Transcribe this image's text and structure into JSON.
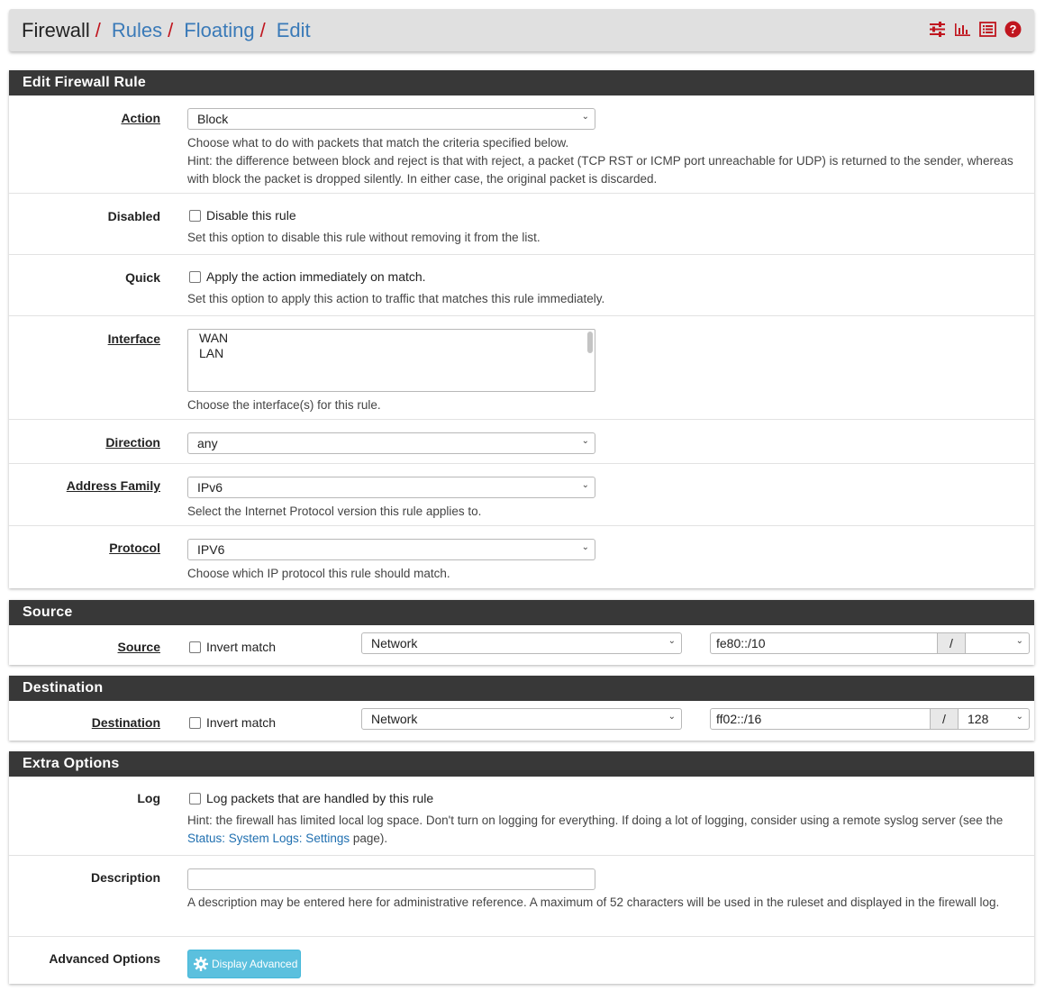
{
  "breadcrumb": {
    "home": "Firewall",
    "items": [
      "Rules",
      "Floating",
      "Edit"
    ]
  },
  "icons": [
    "sliders-icon",
    "bar-chart-icon",
    "list-icon",
    "help-icon"
  ],
  "colors": {
    "accent": "#c0161f",
    "link": "#3a7ab8",
    "header_bg": "#383838",
    "info_button": "#5bc0de"
  },
  "edit_rule": {
    "heading": "Edit Firewall Rule",
    "action": {
      "label": "Action",
      "value": "Block",
      "help1": "Choose what to do with packets that match the criteria specified below.",
      "help2": "Hint: the difference between block and reject is that with reject, a packet (TCP RST or ICMP port unreachable for UDP) is returned to the sender, whereas with block the packet is dropped silently. In either case, the original packet is discarded."
    },
    "disabled": {
      "label": "Disabled",
      "checkbox": "Disable this rule",
      "help": "Set this option to disable this rule without removing it from the list."
    },
    "quick": {
      "label": "Quick",
      "checkbox": "Apply the action immediately on match.",
      "help": "Set this option to apply this action to traffic that matches this rule immediately."
    },
    "interface": {
      "label": "Interface",
      "options": [
        "WAN",
        "LAN"
      ],
      "help": "Choose the interface(s) for this rule."
    },
    "direction": {
      "label": "Direction",
      "value": "any"
    },
    "address_family": {
      "label": "Address Family",
      "value": "IPv6",
      "help": "Select the Internet Protocol version this rule applies to."
    },
    "protocol": {
      "label": "Protocol",
      "value": "IPV6",
      "help": "Choose which IP protocol this rule should match."
    }
  },
  "source": {
    "heading": "Source",
    "label": "Source",
    "invert": "Invert match",
    "type": "Network",
    "address": "fe80::/10",
    "slash": "/",
    "mask": ""
  },
  "destination": {
    "heading": "Destination",
    "label": "Destination",
    "invert": "Invert match",
    "type": "Network",
    "address": "ff02::/16",
    "slash": "/",
    "mask": "128"
  },
  "extra": {
    "heading": "Extra Options",
    "log": {
      "label": "Log",
      "checkbox": "Log packets that are handled by this rule",
      "help_pre": "Hint: the firewall has limited local log space. Don't turn on logging for everything. If doing a lot of logging, consider using a remote syslog server (see the",
      "help_link": "Status: System Logs: Settings",
      "help_post": "page)."
    },
    "description": {
      "label": "Description",
      "value": "",
      "help": "A description may be entered here for administrative reference. A maximum of 52 characters will be used in the ruleset and displayed in the firewall log."
    },
    "advanced": {
      "label": "Advanced Options",
      "button": "Display Advanced"
    }
  }
}
